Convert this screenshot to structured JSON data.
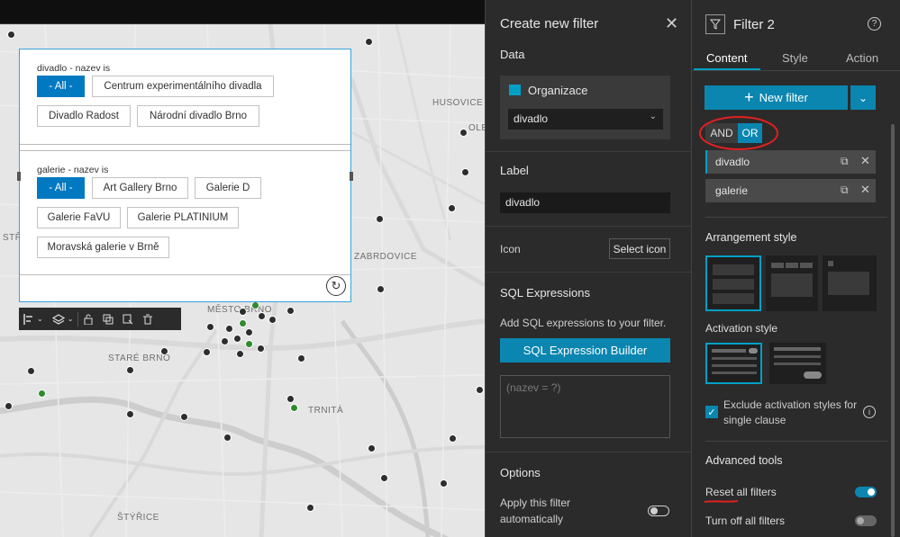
{
  "map": {
    "labels": [
      "HUSOVICE",
      "ZABRDOVICE",
      "STARÉ BRNO",
      "MĚSTO BRNO",
      "TRNITÁ",
      "ŠTÝŘICE",
      "STŘ",
      "OLE",
      "STŘ"
    ],
    "filter_widget": {
      "group1": {
        "label": "divadlo - nazev is",
        "chips": [
          "- All -",
          "Centrum experimentálního divadla",
          "Divadlo Radost",
          "Národní divadlo Brno"
        ]
      },
      "group2": {
        "label": "galerie - nazev is",
        "chips": [
          "- All -",
          "Art Gallery Brno",
          "Galerie D",
          "Galerie FaVU",
          "Galerie PLATINIUM",
          "Moravská galerie v Brně"
        ]
      }
    },
    "toolbar": [
      "align-icon",
      "layers-icon",
      "lock-icon",
      "copy-icon",
      "crop-icon",
      "trash-icon"
    ]
  },
  "create_filter": {
    "title": "Create new filter",
    "data_heading": "Data",
    "data_source_name": "Organizace",
    "data_layer_value": "divadlo",
    "label_heading": "Label",
    "label_value": "divadlo",
    "icon_heading": "Icon",
    "select_icon_label": "Select icon",
    "sql_heading": "SQL Expressions",
    "sql_desc": "Add SQL expressions to your filter.",
    "sql_builder_label": "SQL Expression Builder",
    "sql_expression": "(nazev = ?)",
    "options_heading": "Options",
    "apply_auto_label": "Apply this filter automatically",
    "apply_auto_line1": "Apply this filter",
    "apply_auto_line2": "automatically"
  },
  "filter_panel": {
    "title": "Filter 2",
    "tabs": [
      "Content",
      "Style",
      "Action"
    ],
    "active_tab": "Content",
    "new_filter_label": "New filter",
    "logic": [
      "AND",
      "OR"
    ],
    "active_logic": "OR",
    "filters": [
      "divadlo",
      "galerie"
    ],
    "arrangement_heading": "Arrangement style",
    "activation_heading": "Activation style",
    "exclude_label_line1": "Exclude activation styles for",
    "exclude_label_line2": "single clause",
    "advanced_heading": "Advanced tools",
    "reset_all_label": "Reset all filters",
    "turn_off_label": "Turn off all filters"
  },
  "colors": {
    "accent": "#0079c1",
    "teal": "#00a0c6",
    "panel_bg": "#2b2b2b",
    "annotation_red": "#e02020"
  }
}
